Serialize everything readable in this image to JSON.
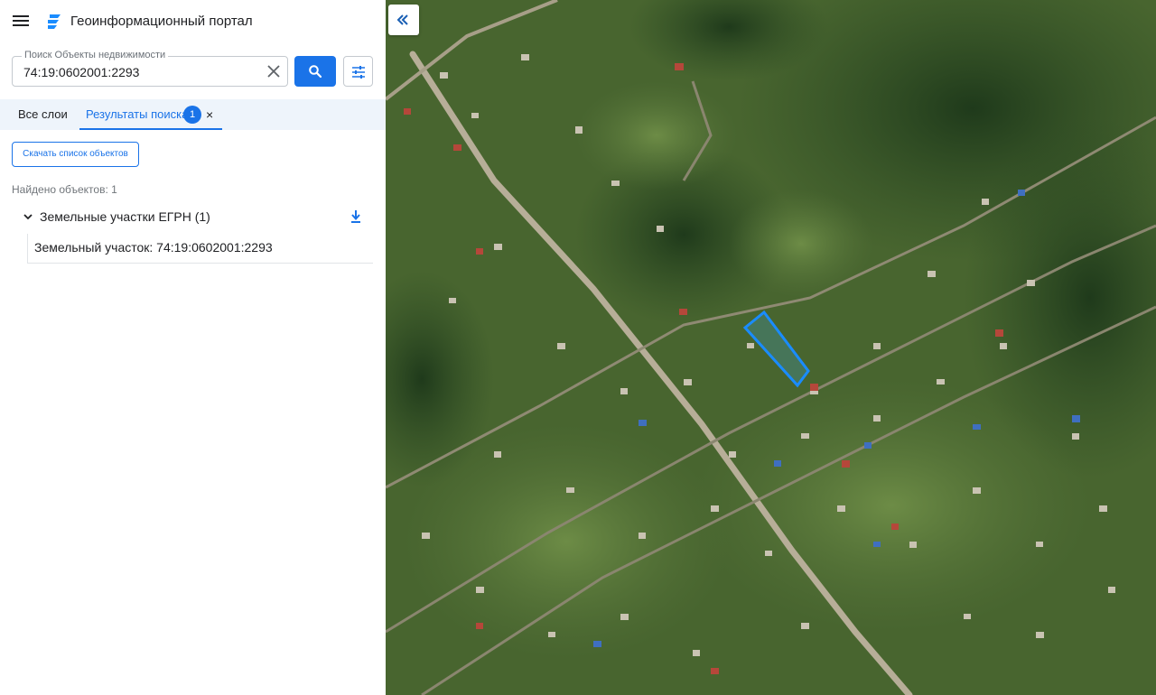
{
  "app": {
    "title": "Геоинформационный портал"
  },
  "search": {
    "legend": "Поиск Объекты недвижимости",
    "value": "74:19:0602001:2293"
  },
  "tabs": {
    "all_layers": "Все слои",
    "results": "Результаты поиска",
    "results_count": "1",
    "close": "×"
  },
  "results": {
    "download_list_label": "Скачать список объектов",
    "found_text": "Найдено объектов: 1",
    "groups": [
      {
        "label": "Земельные участки ЕГРН (1)",
        "items": [
          {
            "label": "Земельный участок: 74:19:0602001:2293"
          }
        ]
      }
    ]
  },
  "colors": {
    "accent": "#1a73e8",
    "tab_bg": "#eef4fb",
    "parcel_outline": "#1a8cff"
  },
  "icons": {
    "menu": "hamburger-menu-icon",
    "logo": "portal-logo-icon",
    "clear": "close-icon",
    "search": "search-icon",
    "filter": "sliders-icon",
    "collapse": "double-chevron-left-icon",
    "expand": "chevron-down-icon",
    "download": "download-icon"
  }
}
